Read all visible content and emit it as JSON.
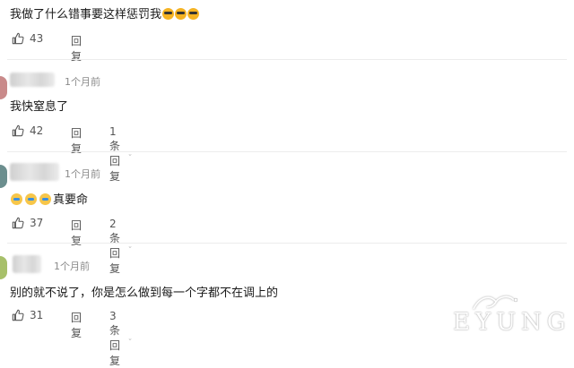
{
  "comments": [
    {
      "text": "我做了什么错事要这样惩罚我",
      "emojis": [
        "cool-emoji",
        "cool-emoji",
        "cool-emoji"
      ],
      "likes": "43",
      "reply_label": "回复"
    },
    {
      "time": "1个月前",
      "text": "我快窒息了",
      "likes": "42",
      "reply_label": "回复",
      "replies_label": "1条回复",
      "avatar_color": "#c98a8a"
    },
    {
      "time": "1个月前",
      "text": "真要命",
      "emojis": [
        "crying-emoji",
        "crying-emoji",
        "crying-emoji"
      ],
      "likes": "37",
      "reply_label": "回复",
      "replies_label": "2条回复",
      "avatar_color": "#6b8e8e"
    },
    {
      "time": "1个月前",
      "text": "别的就不说了，你是怎么做到每一个字都不在调上的",
      "likes": "31",
      "reply_label": "回复",
      "replies_label": "3条回复",
      "avatar_color": "#a7c06a"
    }
  ],
  "watermark": {
    "text": "EYUNG",
    "logo": "flourish-logo"
  },
  "icons": {
    "like": "thumbs-up-icon",
    "expand": "chevron-down-icon"
  }
}
